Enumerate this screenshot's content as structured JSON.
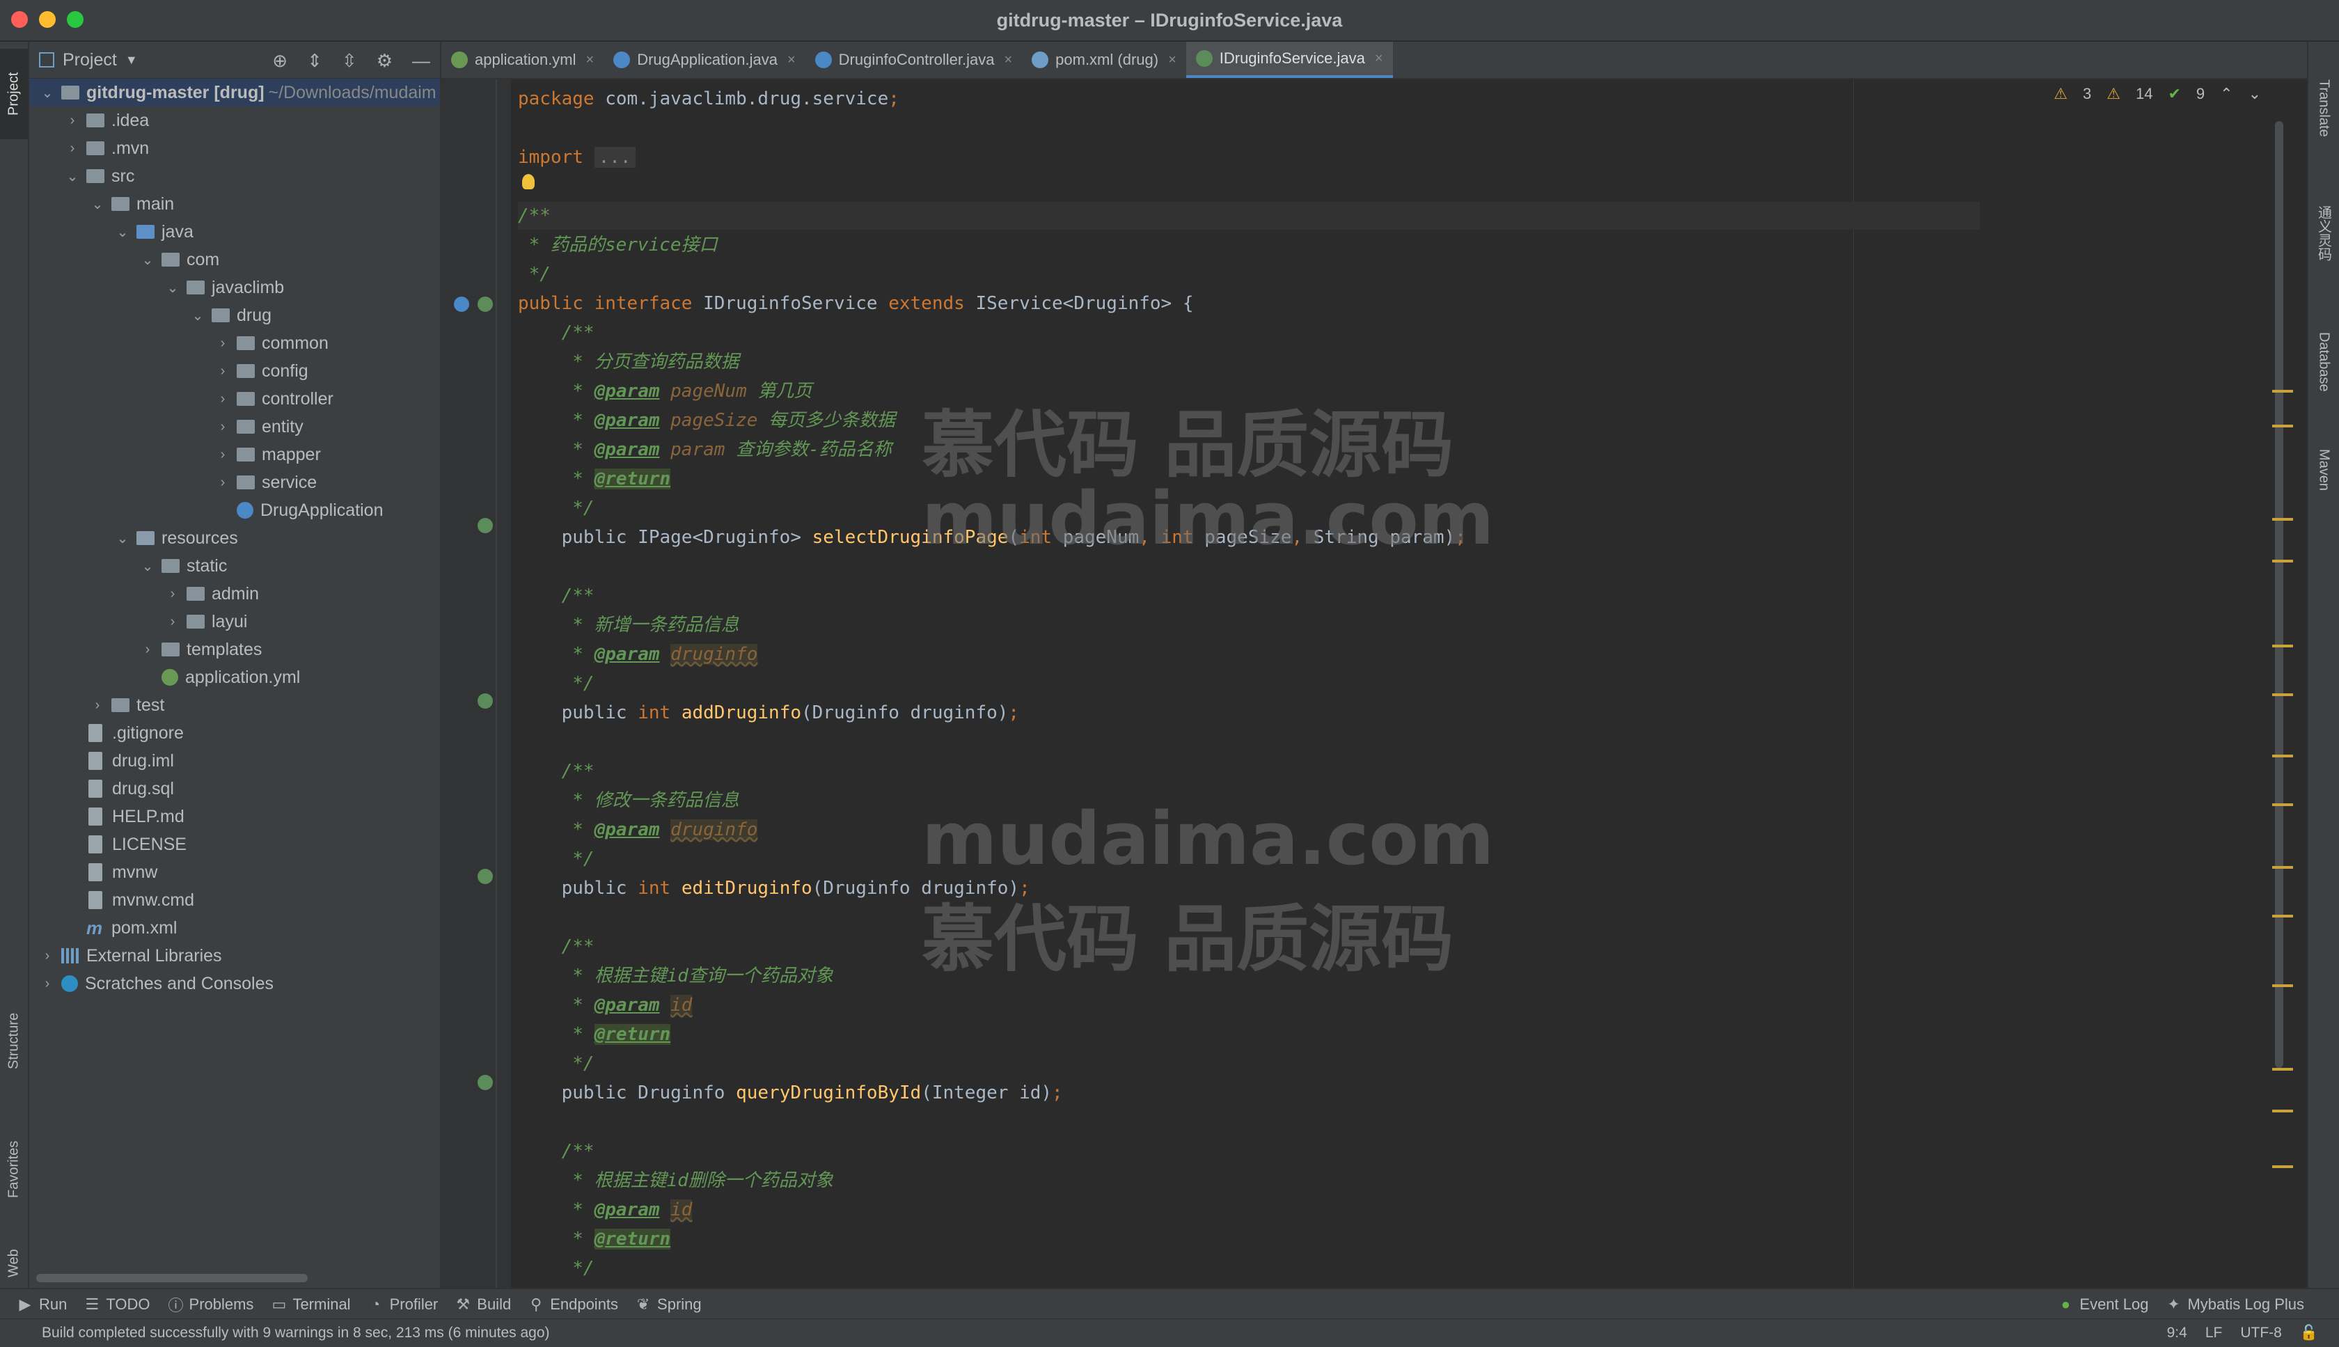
{
  "window": {
    "title": "gitdrug-master – IDruginfoService.java"
  },
  "left_strip": {
    "project": "Project",
    "structure": "Structure",
    "favorites": "Favorites",
    "web": "Web"
  },
  "right_strip": {
    "translate": "Translate",
    "tongyi": "通义灵码",
    "database": "Database",
    "maven": "Maven"
  },
  "project": {
    "header": "Project",
    "tree": [
      {
        "label": "gitdrug-master [drug]",
        "path": "~/Downloads/mudaim",
        "indent": 0,
        "arrow": "open",
        "icon": "folder"
      },
      {
        "label": ".idea",
        "indent": 1,
        "arrow": "closed",
        "icon": "folder"
      },
      {
        "label": ".mvn",
        "indent": 1,
        "arrow": "closed",
        "icon": "folder"
      },
      {
        "label": "src",
        "indent": 1,
        "arrow": "open",
        "icon": "folder"
      },
      {
        "label": "main",
        "indent": 2,
        "arrow": "open",
        "icon": "folder"
      },
      {
        "label": "java",
        "indent": 3,
        "arrow": "open",
        "icon": "folder-blue"
      },
      {
        "label": "com",
        "indent": 4,
        "arrow": "open",
        "icon": "folder"
      },
      {
        "label": "javaclimb",
        "indent": 5,
        "arrow": "open",
        "icon": "folder"
      },
      {
        "label": "drug",
        "indent": 6,
        "arrow": "open",
        "icon": "folder"
      },
      {
        "label": "common",
        "indent": 7,
        "arrow": "closed",
        "icon": "folder"
      },
      {
        "label": "config",
        "indent": 7,
        "arrow": "closed",
        "icon": "folder"
      },
      {
        "label": "controller",
        "indent": 7,
        "arrow": "closed",
        "icon": "folder"
      },
      {
        "label": "entity",
        "indent": 7,
        "arrow": "closed",
        "icon": "folder"
      },
      {
        "label": "mapper",
        "indent": 7,
        "arrow": "closed",
        "icon": "folder"
      },
      {
        "label": "service",
        "indent": 7,
        "arrow": "closed",
        "icon": "folder"
      },
      {
        "label": "DrugApplication",
        "indent": 7,
        "arrow": "none",
        "icon": "java"
      },
      {
        "label": "resources",
        "indent": 3,
        "arrow": "open",
        "icon": "folder-res"
      },
      {
        "label": "static",
        "indent": 4,
        "arrow": "open",
        "icon": "folder"
      },
      {
        "label": "admin",
        "indent": 5,
        "arrow": "closed",
        "icon": "folder"
      },
      {
        "label": "layui",
        "indent": 5,
        "arrow": "closed",
        "icon": "folder"
      },
      {
        "label": "templates",
        "indent": 4,
        "arrow": "closed",
        "icon": "folder"
      },
      {
        "label": "application.yml",
        "indent": 4,
        "arrow": "none",
        "icon": "yml"
      },
      {
        "label": "test",
        "indent": 2,
        "arrow": "closed",
        "icon": "folder"
      },
      {
        "label": ".gitignore",
        "indent": 1,
        "arrow": "none",
        "icon": "file"
      },
      {
        "label": "drug.iml",
        "indent": 1,
        "arrow": "none",
        "icon": "file"
      },
      {
        "label": "drug.sql",
        "indent": 1,
        "arrow": "none",
        "icon": "file"
      },
      {
        "label": "HELP.md",
        "indent": 1,
        "arrow": "none",
        "icon": "file"
      },
      {
        "label": "LICENSE",
        "indent": 1,
        "arrow": "none",
        "icon": "file"
      },
      {
        "label": "mvnw",
        "indent": 1,
        "arrow": "none",
        "icon": "file"
      },
      {
        "label": "mvnw.cmd",
        "indent": 1,
        "arrow": "none",
        "icon": "file"
      },
      {
        "label": "pom.xml",
        "indent": 1,
        "arrow": "none",
        "icon": "mfile"
      },
      {
        "label": "External Libraries",
        "indent": 0,
        "arrow": "closed",
        "icon": "lib"
      },
      {
        "label": "Scratches and Consoles",
        "indent": 0,
        "arrow": "closed",
        "icon": "scratch"
      }
    ]
  },
  "tabs": [
    {
      "label": "application.yml",
      "icon_color": "#6a9955",
      "active": false
    },
    {
      "label": "DrugApplication.java",
      "icon_color": "#4a88c7",
      "active": false
    },
    {
      "label": "DruginfoController.java",
      "icon_color": "#4a88c7",
      "active": false
    },
    {
      "label": "pom.xml (drug)",
      "icon_color": "#6e9ec8",
      "active": false
    },
    {
      "label": "IDruginfoService.java",
      "icon_color": "#5b8c5a",
      "active": true
    }
  ],
  "inspections": {
    "warnings_a": "3",
    "warnings_b": "14",
    "ok": "9"
  },
  "code_lines": [
    {
      "tokens": [
        [
          "kw",
          "package "
        ],
        [
          "plain",
          "com.javaclimb.drug.service"
        ],
        [
          "kw",
          ";"
        ]
      ]
    },
    {
      "tokens": []
    },
    {
      "tokens": [
        [
          "kw",
          "import "
        ],
        [
          "fold",
          "..."
        ]
      ]
    },
    {
      "tokens": []
    },
    {
      "tokens": [
        [
          "doc",
          "/**"
        ]
      ],
      "caret": true
    },
    {
      "tokens": [
        [
          "doc",
          " * 药品的service接口"
        ]
      ]
    },
    {
      "tokens": [
        [
          "doc",
          " */"
        ]
      ]
    },
    {
      "tokens": [
        [
          "kw",
          "public interface "
        ],
        [
          "plain",
          "IDruginfoService "
        ],
        [
          "kw",
          "extends "
        ],
        [
          "plain",
          "IService<Druginfo> {"
        ]
      ]
    },
    {
      "tokens": [
        [
          "doc",
          "    /**"
        ]
      ]
    },
    {
      "tokens": [
        [
          "doc",
          "     * 分页查询药品数据"
        ]
      ]
    },
    {
      "tokens": [
        [
          "doc",
          "     * "
        ],
        [
          "tag",
          "@param"
        ],
        [
          "doc",
          " "
        ],
        [
          "pname",
          "pageNum"
        ],
        [
          "doc",
          " 第几页"
        ]
      ]
    },
    {
      "tokens": [
        [
          "doc",
          "     * "
        ],
        [
          "tag",
          "@param"
        ],
        [
          "doc",
          " "
        ],
        [
          "pname",
          "pageSize"
        ],
        [
          "doc",
          " 每页多少条数据"
        ]
      ]
    },
    {
      "tokens": [
        [
          "doc",
          "     * "
        ],
        [
          "tag",
          "@param"
        ],
        [
          "doc",
          " "
        ],
        [
          "pname",
          "param"
        ],
        [
          "doc",
          " 查询参数-药品名称"
        ]
      ]
    },
    {
      "tokens": [
        [
          "doc",
          "     * "
        ],
        [
          "ret",
          "@return"
        ]
      ]
    },
    {
      "tokens": [
        [
          "doc",
          "     */"
        ]
      ]
    },
    {
      "tokens": [
        [
          "plain",
          "    public IPage<Druginfo> "
        ],
        [
          "method",
          "selectDruginfoPage"
        ],
        [
          "plain",
          "("
        ],
        [
          "kw",
          "int "
        ],
        [
          "plain",
          "pageNum"
        ],
        [
          "comma",
          ", "
        ],
        [
          "kw",
          "int "
        ],
        [
          "plain",
          "pageSize"
        ],
        [
          "comma",
          ", "
        ],
        [
          "plain",
          "String param)"
        ],
        [
          "kw",
          ";"
        ]
      ]
    },
    {
      "tokens": []
    },
    {
      "tokens": [
        [
          "doc",
          "    /**"
        ]
      ]
    },
    {
      "tokens": [
        [
          "doc",
          "     * 新增一条药品信息"
        ]
      ]
    },
    {
      "tokens": [
        [
          "doc",
          "     * "
        ],
        [
          "tag",
          "@param"
        ],
        [
          "doc",
          " "
        ],
        [
          "pdim",
          "druginfo"
        ]
      ]
    },
    {
      "tokens": [
        [
          "doc",
          "     */"
        ]
      ]
    },
    {
      "tokens": [
        [
          "plain",
          "    public "
        ],
        [
          "kw",
          "int "
        ],
        [
          "method",
          "addDruginfo"
        ],
        [
          "plain",
          "(Druginfo druginfo)"
        ],
        [
          "kw",
          ";"
        ]
      ]
    },
    {
      "tokens": []
    },
    {
      "tokens": [
        [
          "doc",
          "    /**"
        ]
      ]
    },
    {
      "tokens": [
        [
          "doc",
          "     * 修改一条药品信息"
        ]
      ]
    },
    {
      "tokens": [
        [
          "doc",
          "     * "
        ],
        [
          "tag",
          "@param"
        ],
        [
          "doc",
          " "
        ],
        [
          "pdim",
          "druginfo"
        ]
      ]
    },
    {
      "tokens": [
        [
          "doc",
          "     */"
        ]
      ]
    },
    {
      "tokens": [
        [
          "plain",
          "    public "
        ],
        [
          "kw",
          "int "
        ],
        [
          "method",
          "editDruginfo"
        ],
        [
          "plain",
          "(Druginfo druginfo)"
        ],
        [
          "kw",
          ";"
        ]
      ]
    },
    {
      "tokens": []
    },
    {
      "tokens": [
        [
          "doc",
          "    /**"
        ]
      ]
    },
    {
      "tokens": [
        [
          "doc",
          "     * 根据主键id查询一个药品对象"
        ]
      ]
    },
    {
      "tokens": [
        [
          "doc",
          "     * "
        ],
        [
          "tag",
          "@param"
        ],
        [
          "doc",
          " "
        ],
        [
          "pdim",
          "id"
        ]
      ]
    },
    {
      "tokens": [
        [
          "doc",
          "     * "
        ],
        [
          "ret",
          "@return"
        ]
      ]
    },
    {
      "tokens": [
        [
          "doc",
          "     */"
        ]
      ]
    },
    {
      "tokens": [
        [
          "plain",
          "    public Druginfo "
        ],
        [
          "method",
          "queryDruginfoById"
        ],
        [
          "plain",
          "(Integer id)"
        ],
        [
          "kw",
          ";"
        ]
      ]
    },
    {
      "tokens": []
    },
    {
      "tokens": [
        [
          "doc",
          "    /**"
        ]
      ]
    },
    {
      "tokens": [
        [
          "doc",
          "     * 根据主键id删除一个药品对象"
        ]
      ]
    },
    {
      "tokens": [
        [
          "doc",
          "     * "
        ],
        [
          "tag",
          "@param"
        ],
        [
          "doc",
          " "
        ],
        [
          "pdim",
          "id"
        ]
      ]
    },
    {
      "tokens": [
        [
          "doc",
          "     * "
        ],
        [
          "ret",
          "@return"
        ]
      ]
    },
    {
      "tokens": [
        [
          "doc",
          "     */"
        ]
      ]
    }
  ],
  "watermarks": {
    "cn": "慕代码 品质源码",
    "en": "mudaima.com"
  },
  "bottom_tools": [
    {
      "label": "Run",
      "icon": "play-icon",
      "glyph": "▶"
    },
    {
      "label": "TODO",
      "icon": "list-icon",
      "glyph": "☰"
    },
    {
      "label": "Problems",
      "icon": "info-icon",
      "glyph": "ⓘ"
    },
    {
      "label": "Terminal",
      "icon": "terminal-icon",
      "glyph": "▭"
    },
    {
      "label": "Profiler",
      "icon": "profiler-icon",
      "glyph": "◔"
    },
    {
      "label": "Build",
      "icon": "hammer-icon",
      "glyph": "⚒"
    },
    {
      "label": "Endpoints",
      "icon": "endpoints-icon",
      "glyph": "⚲"
    },
    {
      "label": "Spring",
      "icon": "spring-icon",
      "glyph": "❦"
    }
  ],
  "bottom_right_tools": [
    {
      "label": "Event Log",
      "icon": "event-log-icon",
      "glyph": "●"
    },
    {
      "label": "Mybatis Log Plus",
      "icon": "mybatis-icon",
      "glyph": "✦"
    }
  ],
  "status": {
    "message": "Build completed successfully with 9 warnings in 8 sec, 213 ms (6 minutes ago)",
    "position": "9:4",
    "line_sep": "LF",
    "encoding": "UTF-8"
  }
}
